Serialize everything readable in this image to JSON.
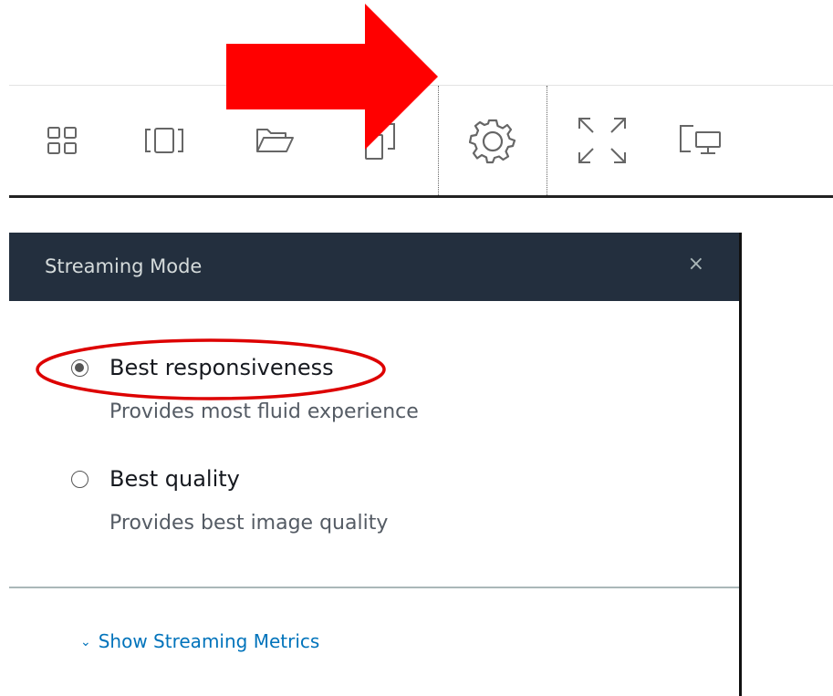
{
  "toolbar": {
    "icons": [
      {
        "name": "applications-icon"
      },
      {
        "name": "windows-icon"
      },
      {
        "name": "folder-icon"
      },
      {
        "name": "clipboard-icon"
      },
      {
        "name": "settings-gear-icon",
        "selected": true
      },
      {
        "name": "fullscreen-icon"
      },
      {
        "name": "switch-display-icon"
      }
    ]
  },
  "panel": {
    "title": "Streaming Mode",
    "close_label": "×",
    "options": [
      {
        "label": "Best responsiveness",
        "description": "Provides most fluid experience",
        "checked": true
      },
      {
        "label": "Best quality",
        "description": "Provides best image quality",
        "checked": false
      }
    ],
    "metrics_chevron": "⌄",
    "metrics_link": "Show Streaming Metrics"
  },
  "annotations": {
    "arrow_color": "#ff0000",
    "ellipse_color": "#dd0000"
  },
  "colors": {
    "header_bg": "#232f3e",
    "link": "#0073bb",
    "text": "#16191f"
  }
}
